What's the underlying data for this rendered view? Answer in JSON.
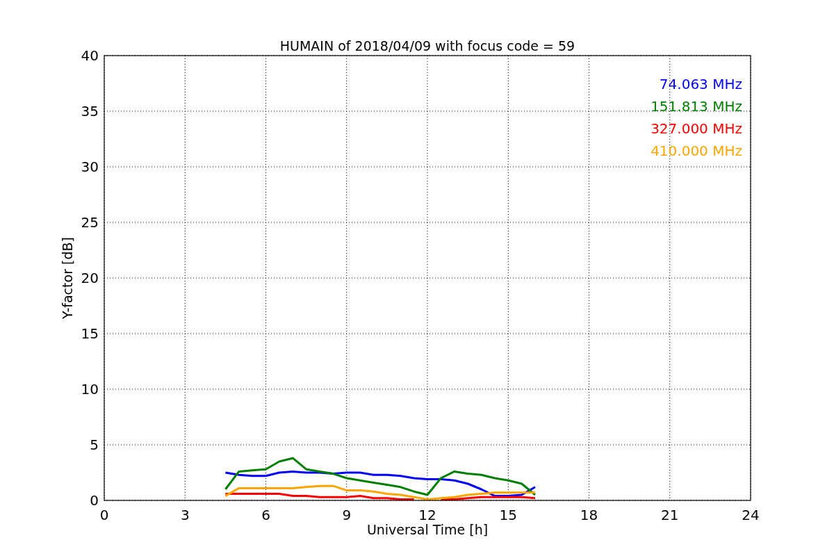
{
  "chart_data": {
    "type": "line",
    "title": "HUMAIN of 2018/04/09 with focus code = 59",
    "xlabel": "Universal Time [h]",
    "ylabel": "Y-factor [dB]",
    "x": [
      4.5,
      5,
      5.5,
      6,
      6.5,
      7,
      7.5,
      8,
      8.5,
      9,
      9.5,
      10,
      10.5,
      11,
      11.5,
      12,
      12.5,
      13,
      13.5,
      14,
      14.5,
      15,
      15.5,
      16
    ],
    "series": [
      {
        "name": "74.063 MHz",
        "color": "#0000ff",
        "values": [
          2.5,
          2.3,
          2.2,
          2.2,
          2.5,
          2.6,
          2.5,
          2.5,
          2.4,
          2.5,
          2.5,
          2.3,
          2.3,
          2.2,
          2.0,
          1.9,
          1.9,
          1.8,
          1.5,
          1.0,
          0.4,
          0.4,
          0.5,
          1.2
        ]
      },
      {
        "name": "151.813 MHz",
        "color": "#008000",
        "values": [
          1.0,
          2.6,
          2.7,
          2.8,
          3.5,
          3.8,
          2.8,
          2.6,
          2.4,
          2.0,
          1.8,
          1.6,
          1.4,
          1.2,
          0.8,
          0.5,
          2.0,
          2.6,
          2.4,
          2.3,
          2.0,
          1.8,
          1.5,
          0.5
        ]
      },
      {
        "name": "327.000 MHz",
        "color": "#ff0000",
        "values": [
          0.6,
          0.6,
          0.6,
          0.6,
          0.6,
          0.4,
          0.4,
          0.3,
          0.3,
          0.3,
          0.4,
          0.2,
          0.2,
          0.1,
          0.1,
          null,
          0.1,
          0.1,
          0.2,
          0.3,
          0.3,
          0.3,
          0.3,
          0.2
        ]
      },
      {
        "name": "410.000 MHz",
        "color": "#ffa500",
        "values": [
          0.4,
          1.1,
          1.1,
          1.1,
          1.1,
          1.1,
          1.2,
          1.3,
          1.3,
          0.9,
          0.9,
          0.8,
          0.6,
          0.5,
          0.3,
          0.1,
          0.2,
          0.3,
          0.5,
          0.6,
          0.7,
          0.7,
          0.7,
          0.7
        ]
      }
    ],
    "xlim": [
      0,
      24
    ],
    "ylim": [
      0,
      40
    ],
    "xticks": [
      0,
      3,
      6,
      9,
      12,
      15,
      18,
      21,
      24
    ],
    "yticks": [
      0,
      5,
      10,
      15,
      20,
      25,
      30,
      35,
      40
    ],
    "grid": true
  }
}
